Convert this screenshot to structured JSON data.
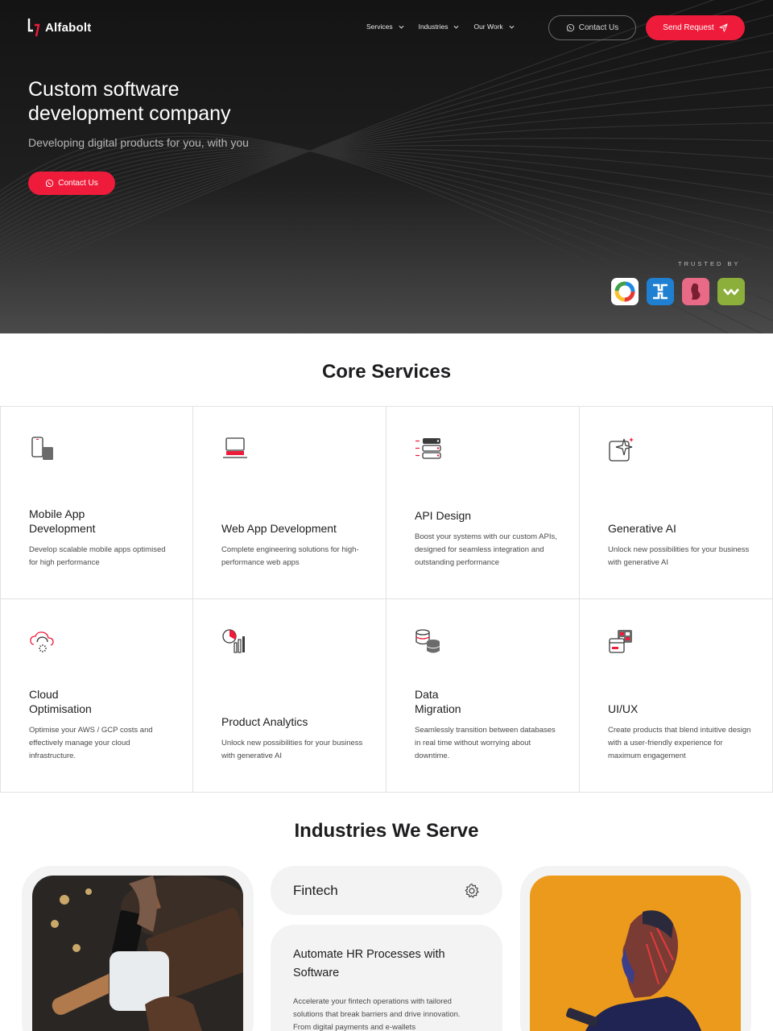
{
  "nav": {
    "logo_text": "Alfabolt",
    "links": [
      {
        "label": "Services"
      },
      {
        "label": "Industries"
      },
      {
        "label": "Our Work"
      }
    ],
    "contact_label": "Contact Us",
    "send_request_label": "Send Request"
  },
  "hero": {
    "title": "Custom software development company",
    "subtitle": "Developing digital products for you, with you",
    "cta_label": "Contact Us",
    "trusted_label": "TRUSTED BY",
    "trusted_logos": [
      "circle-logo-icon",
      "pipe-logo-icon",
      "silhouette-logo-icon",
      "infinity-logo-icon"
    ]
  },
  "core": {
    "title": "Core Services",
    "services": [
      {
        "title": "Mobile App\nDevelopment",
        "desc": "Develop scalable mobile apps optimised for high performance",
        "icon": "mobile-icon"
      },
      {
        "title": "Web App Development",
        "desc": "Complete engineering solutions for high-performance web apps",
        "icon": "laptop-icon"
      },
      {
        "title": "API Design",
        "desc": "Boost your systems with our custom APIs, designed for seamless integration and outstanding performance",
        "icon": "api-server-icon"
      },
      {
        "title": "Generative AI",
        "desc": "Unlock new possibilities for your business with generative AI",
        "icon": "sparkle-icon"
      },
      {
        "title": "Cloud\nOptimisation",
        "desc": "Optimise your AWS / GCP costs and effectively manage your cloud infrastructure.",
        "icon": "cloud-icon"
      },
      {
        "title": "Product Analytics",
        "desc": "Unlock new possibilities for your business with generative AI",
        "icon": "analytics-icon"
      },
      {
        "title": "Data\nMigration",
        "desc": "Seamlessly transition between databases in real time without worrying about downtime.",
        "icon": "database-icon"
      },
      {
        "title": "UI/UX",
        "desc": "Create products that blend intuitive design with a user-friendly experience for maximum engagement",
        "icon": "ui-windows-icon"
      }
    ]
  },
  "industries": {
    "title": "Industries We Serve",
    "active_label": "Fintech",
    "info_title": "Automate HR Processes with Software",
    "info_desc": "Accelerate your fintech operations with tailored solutions that break barriers and drive innovation. From digital payments and e-wallets"
  },
  "colors": {
    "accent": "#ee1c3a",
    "hero_bg": "#161616",
    "text": "#1d1d1f"
  }
}
